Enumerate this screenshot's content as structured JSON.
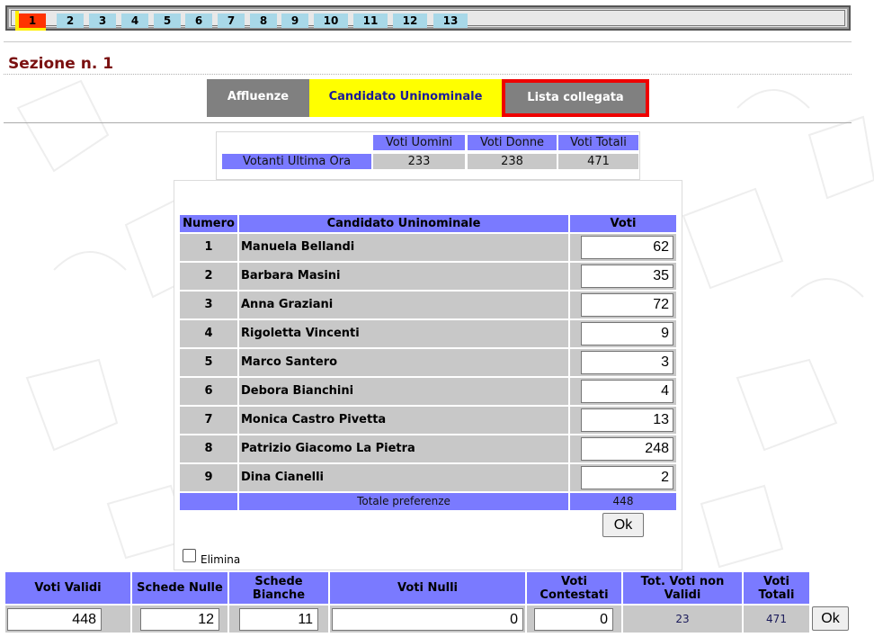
{
  "sections": {
    "tabs": [
      "1",
      "2",
      "3",
      "4",
      "5",
      "6",
      "7",
      "8",
      "9",
      "10",
      "11",
      "12",
      "13"
    ],
    "active": "1"
  },
  "page": {
    "title": "Sezione n. 1"
  },
  "nav": {
    "affluenze": "Affluenze",
    "candidato": "Candidato Uninominale",
    "lista": "Lista collegata"
  },
  "turnout": {
    "headers": [
      "Voti Uomini",
      "Voti Donne",
      "Voti Totali"
    ],
    "row_label": "Votanti Ultima Ora",
    "values": [
      "233",
      "238",
      "471"
    ]
  },
  "candidates": {
    "headers": {
      "number": "Numero",
      "name": "Candidato Uninominale",
      "votes": "Voti"
    },
    "rows": [
      {
        "num": "1",
        "name": "Manuela Bellandi",
        "votes": "62"
      },
      {
        "num": "2",
        "name": "Barbara Masini",
        "votes": "35"
      },
      {
        "num": "3",
        "name": "Anna Graziani",
        "votes": "72"
      },
      {
        "num": "4",
        "name": "Rigoletta Vincenti",
        "votes": "9"
      },
      {
        "num": "5",
        "name": "Marco Santero",
        "votes": "3"
      },
      {
        "num": "6",
        "name": "Debora Bianchini",
        "votes": "4"
      },
      {
        "num": "7",
        "name": "Monica Castro Pivetta",
        "votes": "13"
      },
      {
        "num": "8",
        "name": "Patrizio Giacomo La Pietra",
        "votes": "248"
      },
      {
        "num": "9",
        "name": "Dina Cianelli",
        "votes": "2"
      }
    ],
    "total_label": "Totale preferenze",
    "total_value": "448",
    "ok_label": "Ok",
    "delete_label": "Elimina"
  },
  "totals": {
    "headers": {
      "validi": "Voti Validi",
      "nulle": "Schede Nulle",
      "bianche": "Schede Bianche",
      "nulli": "Voti Nulli",
      "contestati": "Voti Contestati",
      "non_validi": "Tot. Voti non Validi",
      "totali": "Voti Totali"
    },
    "values": {
      "validi": "448",
      "nulle": "12",
      "bianche": "11",
      "nulli": "0",
      "contestati": "0",
      "non_validi": "23",
      "totali": "471"
    },
    "ok_label": "Ok"
  },
  "colors": {
    "header_blue": "#7a7aff",
    "cell_gray": "#c8c8c8",
    "active_tab": "#ff3300",
    "highlight_yellow": "#ffff00",
    "alert_red": "#ee0000",
    "title_maroon": "#7a1010"
  }
}
